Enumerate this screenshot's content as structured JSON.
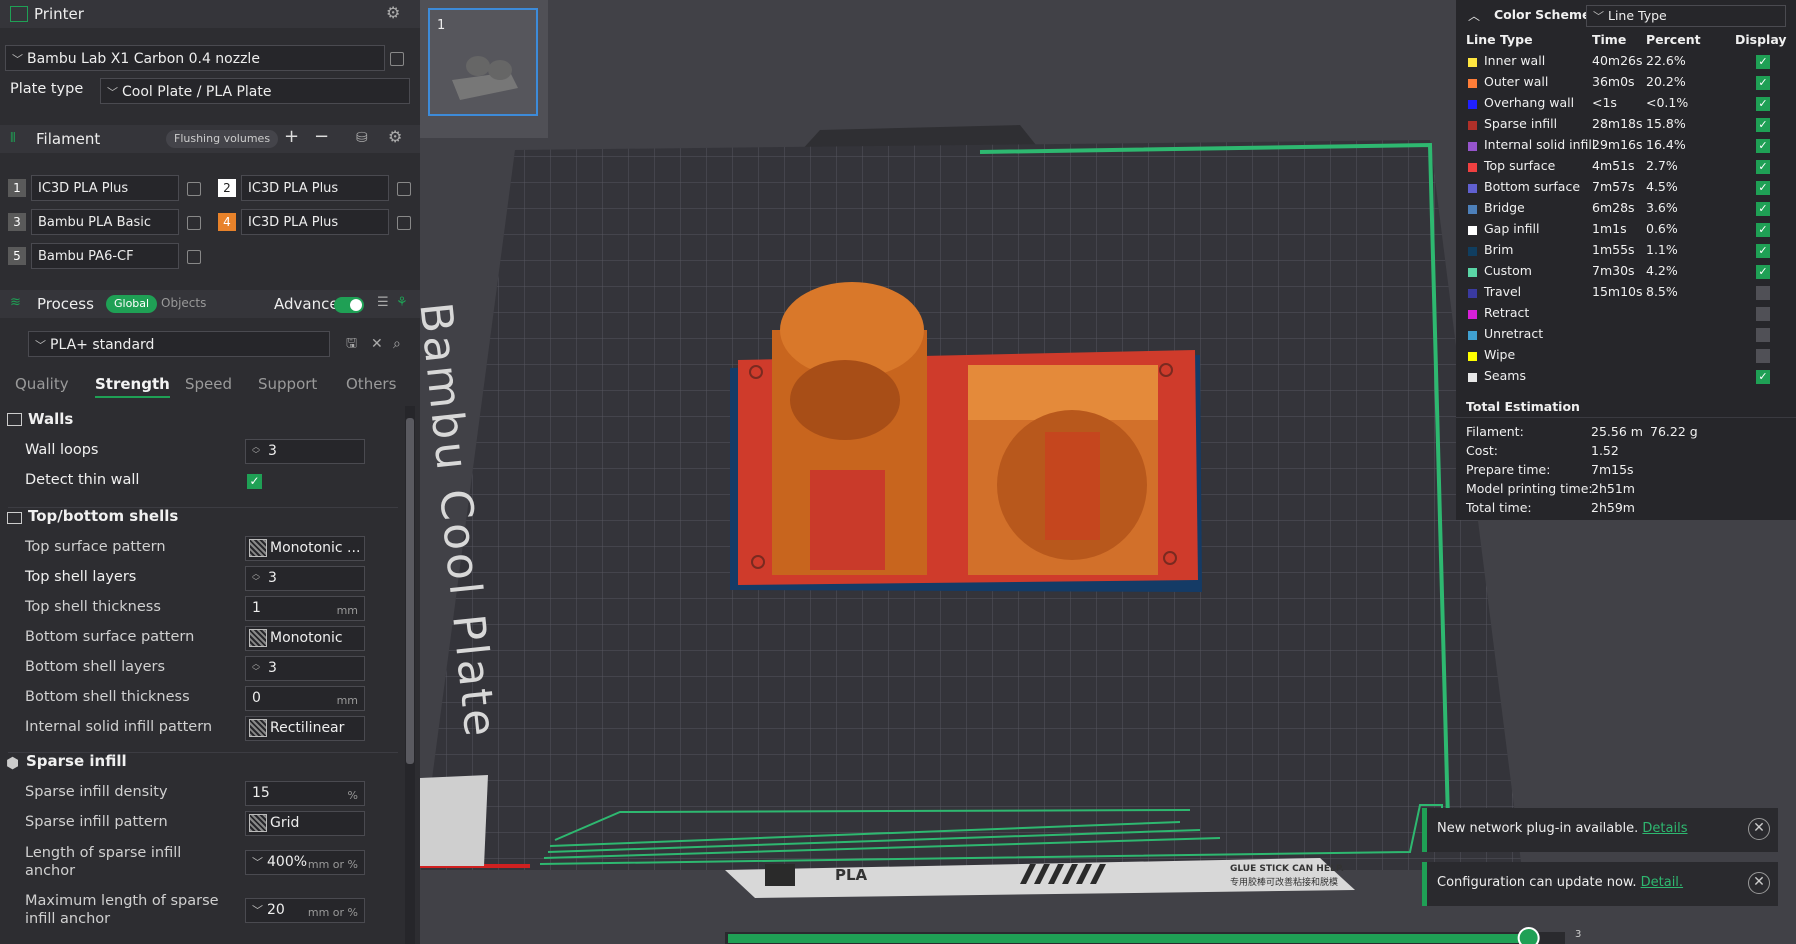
{
  "printer": {
    "title": "Printer",
    "name": "Bambu Lab X1 Carbon 0.4 nozzle",
    "plate_label": "Plate type",
    "plate_value": "Cool Plate / PLA Plate"
  },
  "filament": {
    "title": "Filament",
    "flushing": "Flushing volumes",
    "items": [
      {
        "num": "1",
        "name": "IC3D PLA Plus",
        "color": "#5a5a5a"
      },
      {
        "num": "2",
        "name": "IC3D PLA Plus",
        "color": "#ffffff"
      },
      {
        "num": "3",
        "name": "Bambu PLA Basic",
        "color": "#5a5a5a"
      },
      {
        "num": "4",
        "name": "IC3D PLA Plus",
        "color": "#e8822a"
      },
      {
        "num": "5",
        "name": "Bambu PA6-CF",
        "color": "#5a5a5a"
      }
    ]
  },
  "process": {
    "title": "Process",
    "global": "Global",
    "objects": "Objects",
    "advance": "Advance",
    "preset": "PLA+ standard"
  },
  "tabs": [
    "Quality",
    "Strength",
    "Speed",
    "Support",
    "Others"
  ],
  "walls": {
    "title": "Walls",
    "wall_loops_label": "Wall loops",
    "wall_loops": "3",
    "detect_thin_label": "Detect thin wall"
  },
  "shells": {
    "title": "Top/bottom shells",
    "top_pattern_label": "Top surface pattern",
    "top_pattern": "Monotonic ...",
    "top_layers_label": "Top shell layers",
    "top_layers": "3",
    "top_thick_label": "Top shell thickness",
    "top_thick": "1",
    "mm": "mm",
    "bottom_pattern_label": "Bottom surface pattern",
    "bottom_pattern": "Monotonic",
    "bottom_layers_label": "Bottom shell layers",
    "bottom_layers": "3",
    "bottom_thick_label": "Bottom shell thickness",
    "bottom_thick": "0",
    "internal_pattern_label": "Internal solid infill pattern",
    "internal_pattern": "Rectilinear"
  },
  "sparse": {
    "title": "Sparse infill",
    "density_label": "Sparse infill density",
    "density": "15",
    "pct": "%",
    "pattern_label": "Sparse infill pattern",
    "pattern": "Grid",
    "anchor_label_1": "Length of sparse infill",
    "anchor_label_2": "anchor",
    "anchor": "400%",
    "anchor_unit": "mm or %",
    "max_anchor_label_1": "Maximum length of sparse",
    "max_anchor_label_2": "infill anchor",
    "max_anchor": "20",
    "max_anchor_unit": "mm or %"
  },
  "plate_thumb": {
    "num": "1"
  },
  "bed": {
    "label": "Bambu Cool Plate",
    "strip_pla": "PLA",
    "strip_glue_1": "GLUE STICK CAN HELP.",
    "strip_glue_2": "专用胶棒可改善粘接和脱模"
  },
  "legend": {
    "title": "Color Scheme",
    "scheme": "Line Type",
    "headers": [
      "Line Type",
      "Time",
      "Percent",
      "Display"
    ],
    "rows": [
      {
        "name": "Inner wall",
        "time": "40m26s",
        "pct": "22.6%",
        "color": "#ffe640",
        "on": true
      },
      {
        "name": "Outer wall",
        "time": "36m0s",
        "pct": "20.2%",
        "color": "#ff7d38",
        "on": true
      },
      {
        "name": "Overhang wall",
        "time": "<1s",
        "pct": "<0.1%",
        "color": "#2020ff",
        "on": true
      },
      {
        "name": "Sparse infill",
        "time": "28m18s",
        "pct": "15.8%",
        "color": "#b03029",
        "on": true
      },
      {
        "name": "Internal solid infill",
        "time": "29m16s",
        "pct": "16.4%",
        "color": "#9654cc",
        "on": true
      },
      {
        "name": "Top surface",
        "time": "4m51s",
        "pct": "2.7%",
        "color": "#f04040",
        "on": true
      },
      {
        "name": "Bottom surface",
        "time": "7m57s",
        "pct": "4.5%",
        "color": "#6060d0",
        "on": true
      },
      {
        "name": "Bridge",
        "time": "6m28s",
        "pct": "3.6%",
        "color": "#4d80ba",
        "on": true
      },
      {
        "name": "Gap infill",
        "time": "1m1s",
        "pct": "0.6%",
        "color": "#ffffff",
        "on": true
      },
      {
        "name": "Brim",
        "time": "1m55s",
        "pct": "1.1%",
        "color": "#103e60",
        "on": true
      },
      {
        "name": "Custom",
        "time": "7m30s",
        "pct": "4.2%",
        "color": "#5ad5a5",
        "on": true
      },
      {
        "name": "Travel",
        "time": "15m10s",
        "pct": "8.5%",
        "color": "#3a3aa0",
        "on": false
      },
      {
        "name": "Retract",
        "time": "",
        "pct": "",
        "color": "#d820d8",
        "on": false
      },
      {
        "name": "Unretract",
        "time": "",
        "pct": "",
        "color": "#40a0d0",
        "on": false
      },
      {
        "name": "Wipe",
        "time": "",
        "pct": "",
        "color": "#ffff00",
        "on": false
      },
      {
        "name": "Seams",
        "time": "",
        "pct": "",
        "color": "#e8e8e8",
        "on": true
      }
    ],
    "total_title": "Total Estimation",
    "totals": [
      {
        "k": "Filament:",
        "v": "25.56 m",
        "v2": "76.22 g"
      },
      {
        "k": "Cost:",
        "v": "1.52",
        "v2": ""
      },
      {
        "k": "Prepare time:",
        "v": "7m15s",
        "v2": ""
      },
      {
        "k": "Model printing time:",
        "v": "2h51m",
        "v2": ""
      },
      {
        "k": "Total time:",
        "v": "2h59m",
        "v2": ""
      }
    ]
  },
  "notifications": [
    {
      "text": "New network plug-in available.",
      "link": "Details"
    },
    {
      "text": "Configuration can update now.",
      "link": "Detail."
    }
  ],
  "layer_slider": {
    "label": "3",
    "fraction": 0.96
  }
}
